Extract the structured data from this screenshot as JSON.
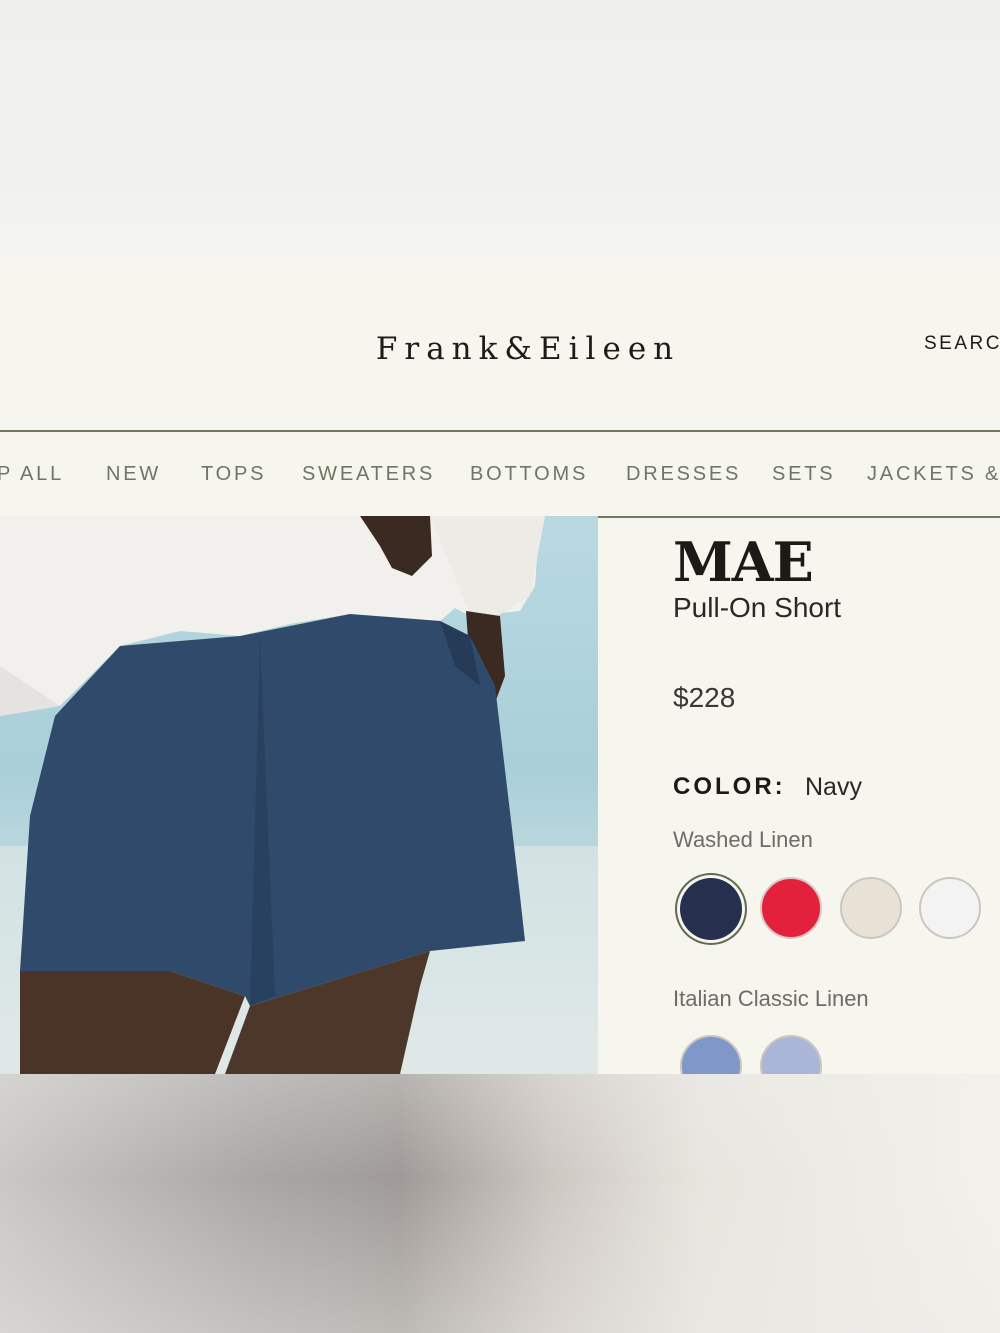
{
  "header": {
    "logo": "Frank&Eileen",
    "search_label": "SEARC"
  },
  "nav": {
    "items": [
      "P ALL",
      "NEW",
      "TOPS",
      "SWEATERS",
      "BOTTOMS",
      "DRESSES",
      "SETS",
      "JACKETS &"
    ]
  },
  "product": {
    "name": "MAE",
    "subtitle": "Pull-On Short",
    "price": "$228",
    "color_label": "COLOR:",
    "color_value": "Navy",
    "fabric_groups": [
      {
        "label": "Washed Linen",
        "swatches": [
          {
            "name": "Navy",
            "color": "#262f4d",
            "selected": true
          },
          {
            "name": "Red",
            "color": "#e3213c",
            "selected": false
          },
          {
            "name": "Natural",
            "color": "#e7e2d5",
            "selected": false
          },
          {
            "name": "White",
            "color": "#f3f3f4",
            "selected": false
          }
        ]
      },
      {
        "label": "Italian Classic Linen",
        "swatches": [
          {
            "name": "Chambray Blue",
            "color": "#7f98c9",
            "selected": false
          },
          {
            "name": "Light Blue",
            "color": "#a9b6d8",
            "selected": false
          }
        ]
      }
    ]
  },
  "colors": {
    "background": "#f6f5ee",
    "nav_text": "#6e7763",
    "nav_border": "#6f7a5c",
    "text_dark": "#1c1a17"
  }
}
